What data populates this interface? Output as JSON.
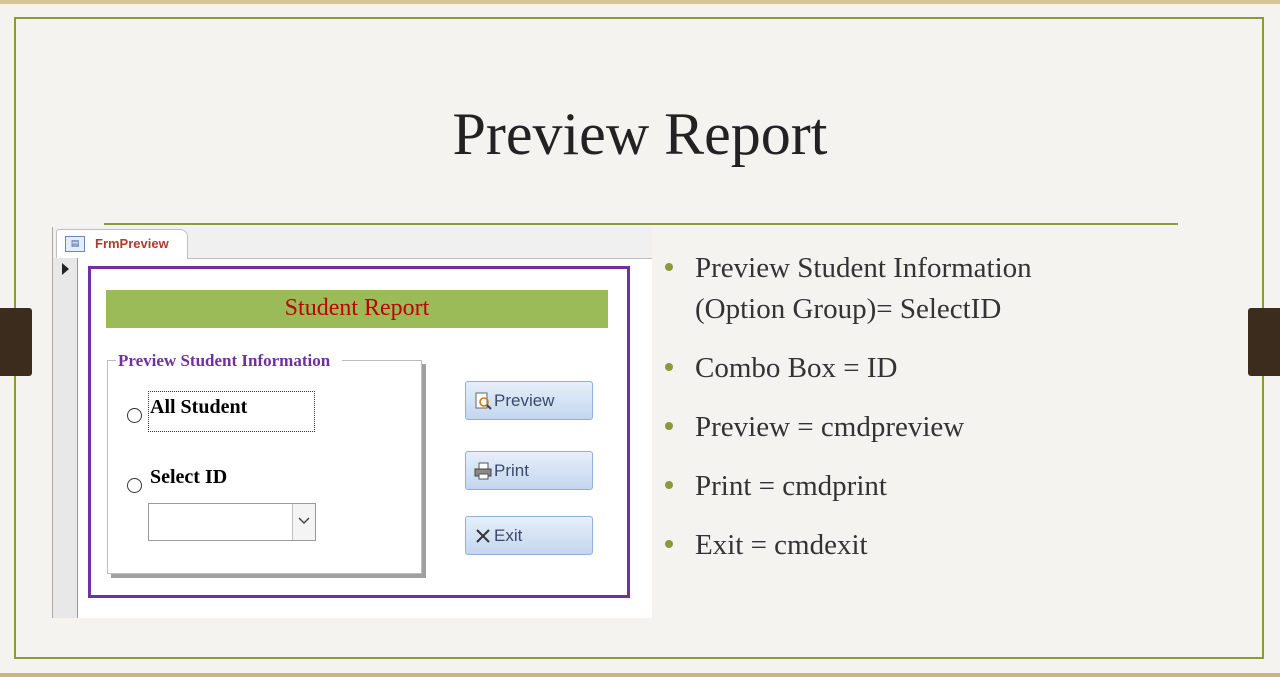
{
  "slide": {
    "title": "Preview Report"
  },
  "access_form": {
    "tab_label": "FrmPreview",
    "header": "Student Report",
    "option_group": {
      "legend": "Preview Student Information",
      "options": [
        "All Student",
        "Select ID"
      ],
      "selected": null
    },
    "combo": {
      "value": ""
    },
    "buttons": {
      "preview": "Preview",
      "print": "Print",
      "exit": "Exit"
    },
    "colors": {
      "header_bg": "#9bbb59",
      "header_text": "#c00000",
      "form_border": "#7030a0",
      "legend_text": "#7030a0",
      "tab_text": "#b03a2e"
    }
  },
  "bullets": [
    {
      "lines": [
        "Preview Student Information",
        "(Option Group)= SelectID"
      ]
    },
    {
      "lines": [
        "Combo Box = ID"
      ]
    },
    {
      "lines": [
        "Preview = cmdpreview"
      ]
    },
    {
      "lines": [
        "Print = cmdprint"
      ]
    },
    {
      "lines": [
        "Exit = cmdexit"
      ]
    }
  ],
  "theme": {
    "accent": "#8a9a3a",
    "side_tab": "#3c2c1e"
  }
}
